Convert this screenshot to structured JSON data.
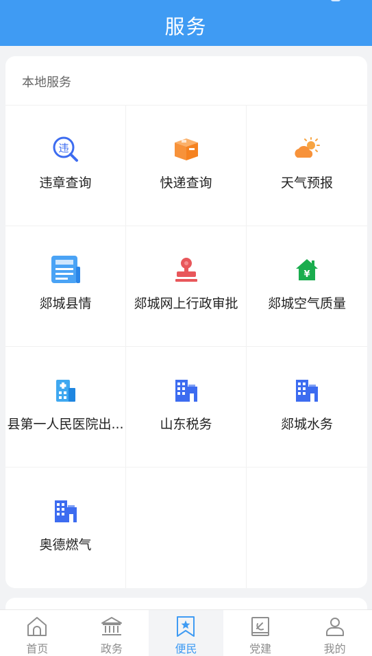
{
  "header": {
    "title": "服务"
  },
  "section": {
    "title": "本地服务",
    "items": [
      {
        "label": "违章查询",
        "icon": "violation-search-icon"
      },
      {
        "label": "快递查询",
        "icon": "package-icon"
      },
      {
        "label": "天气预报",
        "icon": "weather-icon"
      },
      {
        "label": "郯城县情",
        "icon": "document-icon"
      },
      {
        "label": "郯城网上行政审批",
        "icon": "stamp-icon"
      },
      {
        "label": "郯城空气质量",
        "icon": "house-yen-icon"
      },
      {
        "label": "县第一人民医院出...",
        "icon": "hospital-icon"
      },
      {
        "label": "山东税务",
        "icon": "building-icon"
      },
      {
        "label": "郯城水务",
        "icon": "building-icon"
      },
      {
        "label": "奥德燃气",
        "icon": "building-icon"
      }
    ]
  },
  "tabbar": {
    "tabs": [
      {
        "label": "首页",
        "icon": "home-icon",
        "active": false
      },
      {
        "label": "政务",
        "icon": "government-icon",
        "active": false
      },
      {
        "label": "便民",
        "icon": "bookmark-star-icon",
        "active": true
      },
      {
        "label": "党建",
        "icon": "party-icon",
        "active": false
      },
      {
        "label": "我的",
        "icon": "user-icon",
        "active": false
      }
    ]
  },
  "colors": {
    "header": "#3f9bf3",
    "active_tab": "#3f9bf3",
    "inactive_tab": "#8e8e8e",
    "building_blue": "#3d6cf0",
    "package_orange": "#f7923a",
    "stamp_red": "#e8575b",
    "house_green": "#1aad4e"
  }
}
